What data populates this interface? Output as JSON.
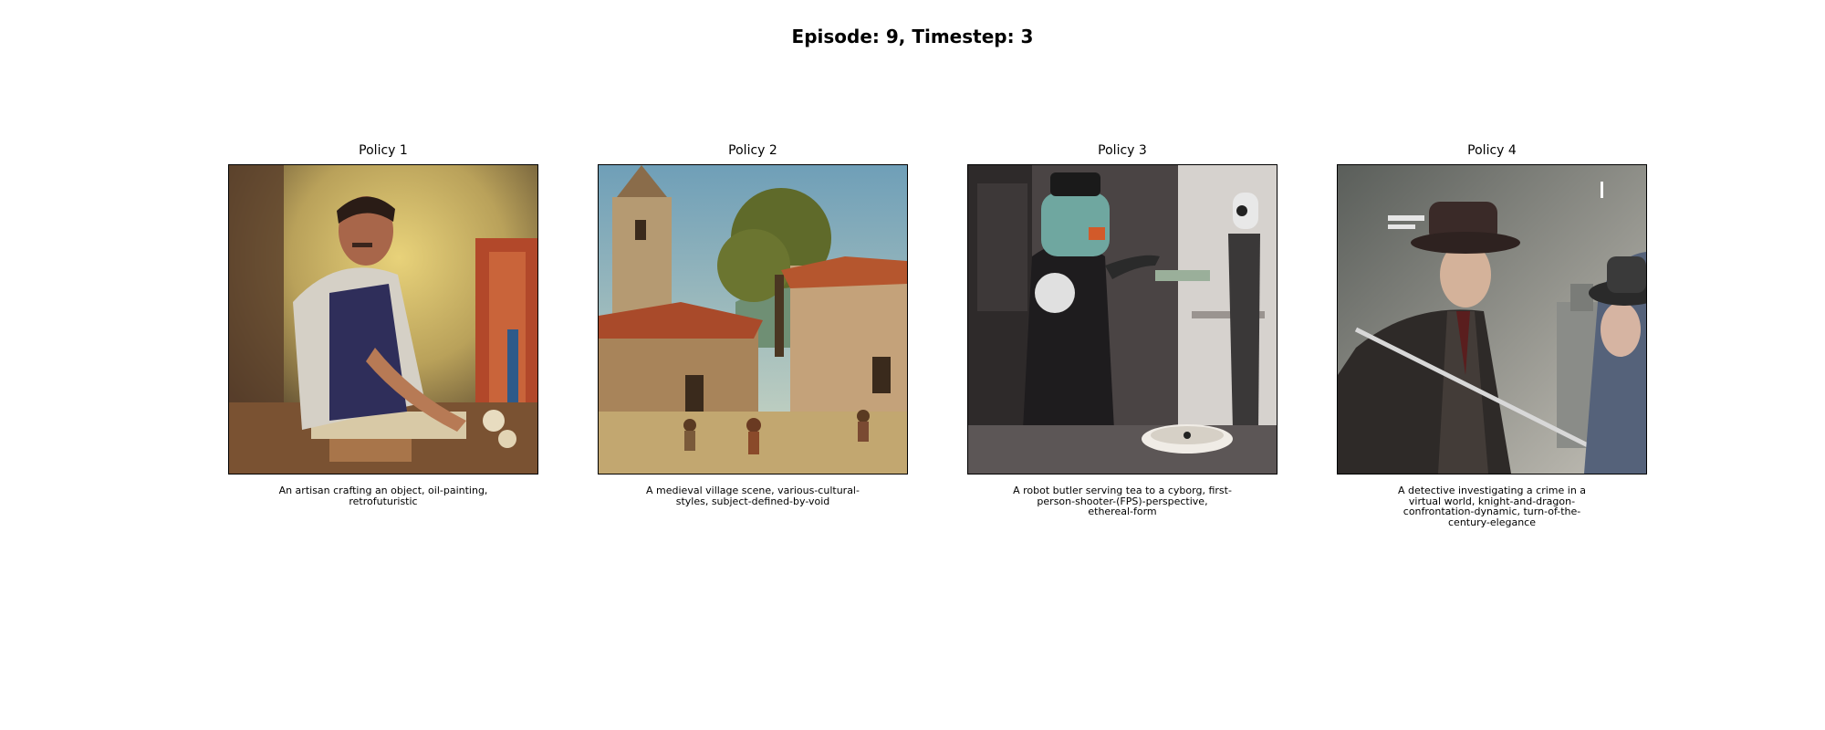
{
  "figure": {
    "suptitle": "Episode: 9, Timestep: 3"
  },
  "panels": [
    {
      "title": "Policy 1",
      "caption": "An artisan crafting an object, oil-painting, retrofuturistic"
    },
    {
      "title": "Policy 2",
      "caption": "A medieval village scene, various-cultural-styles, subject-defined-by-void"
    },
    {
      "title": "Policy 3",
      "caption": "A robot butler serving tea to a cyborg, first-person-shooter-(FPS)-perspective, ethereal-form"
    },
    {
      "title": "Policy 4",
      "caption": "A detective investigating a crime in a virtual world, knight-and-dragon-confrontation-dynamic, turn-of-the-century-elegance"
    }
  ]
}
